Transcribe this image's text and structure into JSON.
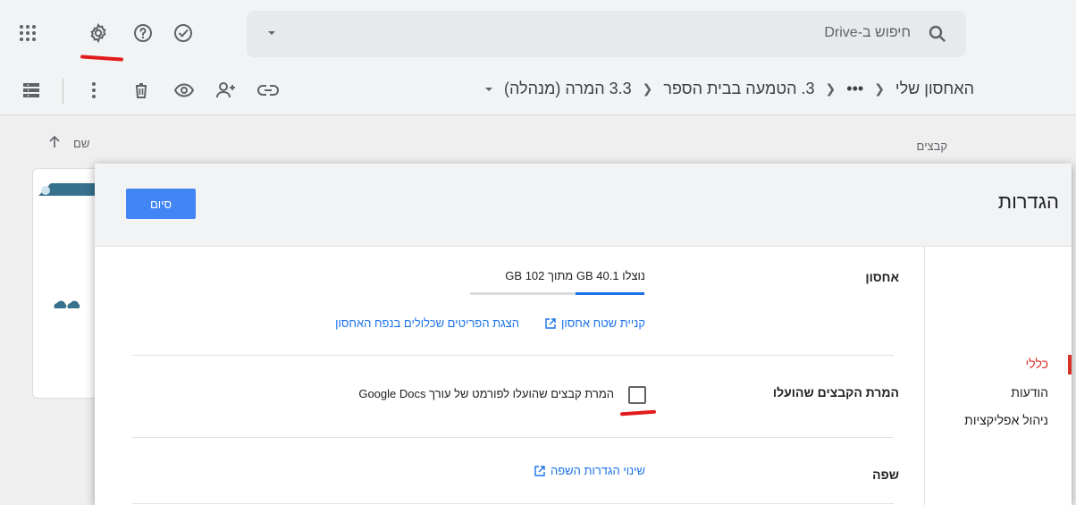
{
  "search": {
    "placeholder": "חיפוש ב-Drive"
  },
  "breadcrumb": {
    "items": [
      "האחסון שלי",
      "•••",
      "3. הטמעה בבית הספר",
      "3.3 המרה (מנהלה)"
    ]
  },
  "files": {
    "label": "קבצים",
    "name_column": "שם"
  },
  "dialog": {
    "title": "הגדרות",
    "done_label": "סיום",
    "nav": [
      "כללי",
      "הודעות",
      "ניהול אפליקציות"
    ],
    "storage": {
      "label": "אחסון",
      "usage_text": "נוצלו 40.1 GB מתוך 102 GB",
      "used_gb": 40.1,
      "total_gb": 102,
      "buy_link": "קניית שטח אחסון",
      "view_items_link": "הצגת הפריטים שכלולים בנפח האחסון"
    },
    "convert": {
      "label": "המרת הקבצים שהועלו",
      "checkbox_label": "המרת קבצים שהועלו לפורמט של עורך Google Docs",
      "checked": false
    },
    "language": {
      "label": "שפה",
      "link": "שינוי הגדרות השפה"
    }
  },
  "colors": {
    "accent": "#4285f4",
    "link": "#1a73e8",
    "active_nav": "#d93025",
    "annotation": "#e11b1b"
  }
}
